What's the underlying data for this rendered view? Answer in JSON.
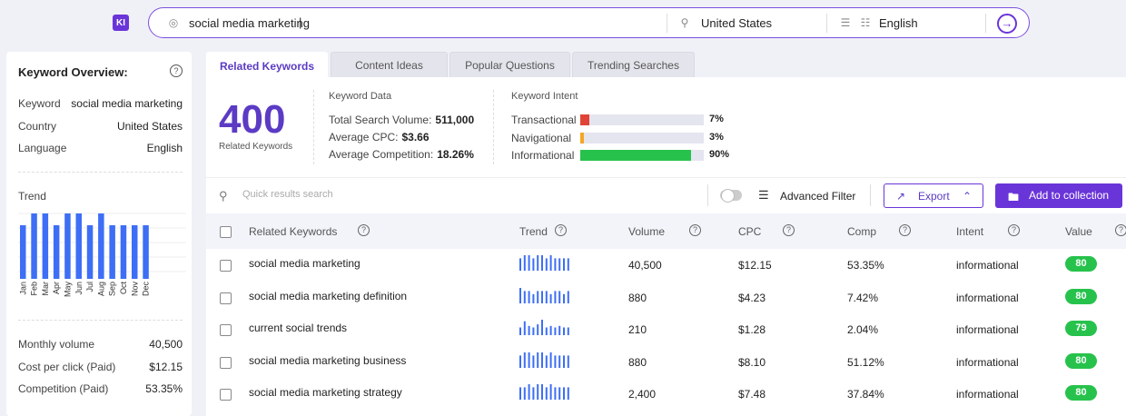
{
  "app": {
    "logo_text": "KI",
    "accent_color": "#6a35d8"
  },
  "search": {
    "query": "social media marketing",
    "country": "United States",
    "language": "English",
    "go_icon": "arrow-enter-icon"
  },
  "overview": {
    "title": "Keyword Overview:",
    "keyword_label": "Keyword",
    "keyword_value": "social media marketing",
    "country_label": "Country",
    "country_value": "United States",
    "language_label": "Language",
    "language_value": "English",
    "trend_label": "Trend",
    "monthly_volume_label": "Monthly volume",
    "monthly_volume_value": "40,500",
    "cpc_label": "Cost per click (Paid)",
    "cpc_value": "$12.15",
    "competition_label": "Competition (Paid)",
    "competition_value": "53.35%"
  },
  "chart_data": {
    "type": "bar",
    "categories": [
      "Jan",
      "Feb",
      "Mar",
      "Apr",
      "May",
      "Jun",
      "Jul",
      "Aug",
      "Sep",
      "Oct",
      "Nov",
      "Dec"
    ],
    "values": [
      0.82,
      1.0,
      1.0,
      0.82,
      1.0,
      1.0,
      0.82,
      1.0,
      0.82,
      0.82,
      0.82,
      0.82
    ],
    "title": "",
    "xlabel": "",
    "ylabel": "",
    "ylim": [
      0,
      1
    ],
    "grid": true,
    "color": "#3d6ef5"
  },
  "tabs": [
    {
      "label": "Related Keywords",
      "active": true
    },
    {
      "label": "Content Ideas",
      "active": false
    },
    {
      "label": "Popular Questions",
      "active": false
    },
    {
      "label": "Trending Searches",
      "active": false
    }
  ],
  "summary": {
    "count": "400",
    "count_label": "Related Keywords",
    "keyword_data_title": "Keyword Data",
    "total_volume_label": "Total Search Volume:",
    "total_volume_value": "511,000",
    "avg_cpc_label": "Average CPC:",
    "avg_cpc_value": "$3.66",
    "avg_comp_label": "Average Competition:",
    "avg_comp_value": "18.26%",
    "intent_title": "Keyword Intent",
    "intents": [
      {
        "label": "Transactional",
        "pct": "7%",
        "value": 0.07,
        "color": "#e04437"
      },
      {
        "label": "Navigational",
        "pct": "3%",
        "value": 0.03,
        "color": "#f5a623"
      },
      {
        "label": "Informational",
        "pct": "90%",
        "value": 0.9,
        "color": "#27c24c"
      }
    ]
  },
  "toolbar": {
    "search_placeholder": "Quick results search",
    "advanced_filter_label": "Advanced Filter",
    "export_label": "Export",
    "add_collection_label": "Add to collection"
  },
  "table": {
    "headers": {
      "keyword": "Related Keywords",
      "trend": "Trend",
      "volume": "Volume",
      "cpc": "CPC",
      "comp": "Comp",
      "intent": "Intent",
      "value": "Value"
    },
    "rows": [
      {
        "keyword": "social media marketing",
        "volume": "40,500",
        "cpc": "$12.15",
        "comp": "53.35%",
        "intent": "informational",
        "value": "80",
        "trend": [
          0.8,
          1,
          1,
          0.8,
          1,
          1,
          0.8,
          1,
          0.8,
          0.8,
          0.8,
          0.8
        ]
      },
      {
        "keyword": "social media marketing definition",
        "volume": "880",
        "cpc": "$4.23",
        "comp": "7.42%",
        "intent": "informational",
        "value": "80",
        "trend": [
          1,
          0.8,
          0.8,
          0.6,
          0.8,
          0.8,
          0.8,
          0.6,
          0.8,
          0.8,
          0.6,
          0.8
        ]
      },
      {
        "keyword": "current social trends",
        "volume": "210",
        "cpc": "$1.28",
        "comp": "2.04%",
        "intent": "informational",
        "value": "79",
        "trend": [
          0.5,
          0.9,
          0.6,
          0.5,
          0.7,
          1,
          0.5,
          0.6,
          0.5,
          0.6,
          0.5,
          0.5
        ]
      },
      {
        "keyword": "social media marketing business",
        "volume": "880",
        "cpc": "$8.10",
        "comp": "51.12%",
        "intent": "informational",
        "value": "80",
        "trend": [
          0.8,
          1,
          1,
          0.8,
          1,
          1,
          0.8,
          1,
          0.8,
          0.8,
          0.8,
          0.8
        ]
      },
      {
        "keyword": "social media marketing strategy",
        "volume": "2,400",
        "cpc": "$7.48",
        "comp": "37.84%",
        "intent": "informational",
        "value": "80",
        "trend": [
          0.8,
          0.8,
          1,
          0.8,
          1,
          1,
          0.8,
          1,
          0.8,
          0.8,
          0.8,
          0.8
        ]
      }
    ]
  }
}
